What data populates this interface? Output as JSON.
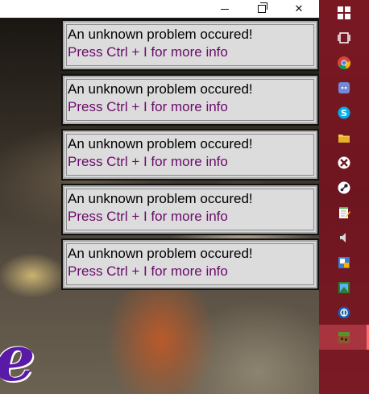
{
  "window": {
    "controls": {
      "minimize_icon": "minimize-icon",
      "maximize_icon": "restore-icon",
      "close_icon": "close-icon",
      "close_glyph": "✕"
    }
  },
  "background": {
    "partial_text": "e"
  },
  "popups": [
    {
      "title": "An unknown problem occured!",
      "hint": "Press Ctrl + I for more info"
    },
    {
      "title": "An unknown problem occured!",
      "hint": "Press Ctrl + I for more info"
    },
    {
      "title": "An unknown problem occured!",
      "hint": "Press Ctrl + I for more info"
    },
    {
      "title": "An unknown problem occured!",
      "hint": "Press Ctrl + I for more info"
    },
    {
      "title": "An unknown problem occured!",
      "hint": "Press Ctrl + I for more info"
    }
  ],
  "colors": {
    "popup_hint": "#6a0a6a",
    "taskbar": "#7a1822",
    "taskbar_active": "#a8343f"
  },
  "taskbar": {
    "items": [
      {
        "icon": "windows-start-icon"
      },
      {
        "icon": "task-view-icon"
      },
      {
        "icon": "chrome-icon"
      },
      {
        "icon": "discord-icon"
      },
      {
        "icon": "skype-icon"
      },
      {
        "icon": "file-explorer-icon"
      },
      {
        "icon": "xbox-icon"
      },
      {
        "icon": "steam-icon"
      },
      {
        "icon": "notepad-icon"
      },
      {
        "icon": "volume-icon"
      },
      {
        "icon": "app-icon-1"
      },
      {
        "icon": "app-icon-2"
      },
      {
        "icon": "app-icon-3"
      },
      {
        "icon": "minecraft-icon",
        "active": true
      }
    ]
  }
}
